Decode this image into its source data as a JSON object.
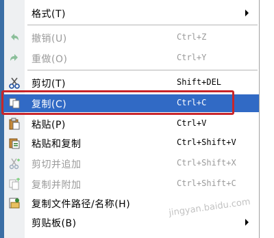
{
  "menu": {
    "items": [
      {
        "label": "格式(T)",
        "shortcut": "",
        "icon": "",
        "disabled": false,
        "submenu": true
      },
      {
        "label": "撤销(U)",
        "shortcut": "Ctrl+Z",
        "icon": "undo-icon",
        "disabled": true,
        "submenu": false
      },
      {
        "label": "重做(O)",
        "shortcut": "Ctrl+Y",
        "icon": "redo-icon",
        "disabled": true,
        "submenu": false
      },
      {
        "label": "剪切(T)",
        "shortcut": "Shift+DEL",
        "icon": "scissors-icon",
        "disabled": false,
        "submenu": false
      },
      {
        "label": "复制(C)",
        "shortcut": "Ctrl+C",
        "icon": "copy-icon",
        "disabled": false,
        "submenu": false,
        "selected": true
      },
      {
        "label": "粘贴(P)",
        "shortcut": "Ctrl+V",
        "icon": "paste-icon",
        "disabled": false,
        "submenu": false
      },
      {
        "label": "粘贴和复制",
        "shortcut": "Ctrl+Shift+V",
        "icon": "paste-copy-icon",
        "disabled": false,
        "submenu": false
      },
      {
        "label": "剪切并追加",
        "shortcut": "Ctrl+Shift+X",
        "icon": "cut-append-icon",
        "disabled": true,
        "submenu": false
      },
      {
        "label": "复制并附加",
        "shortcut": "Ctrl+Shift+C",
        "icon": "copy-append-icon",
        "disabled": true,
        "submenu": false
      },
      {
        "label": "复制文件路径/名称(H)",
        "shortcut": "",
        "icon": "copy-path-icon",
        "disabled": false,
        "submenu": false
      },
      {
        "label": "剪贴板(B)",
        "shortcut": "",
        "icon": "",
        "disabled": false,
        "submenu": true
      }
    ]
  },
  "colors": {
    "selection": "#316ac5",
    "callout": "#c8252a",
    "disabled_text": "#9a9a9a"
  },
  "watermark": "jingyan.baidu.com"
}
